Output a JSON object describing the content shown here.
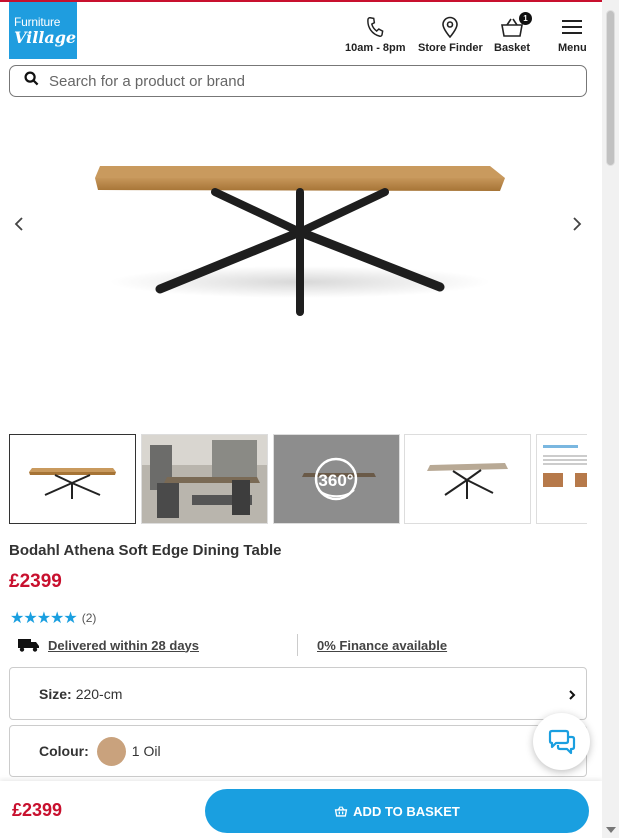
{
  "header": {
    "logo_line1": "Furniture",
    "logo_line2": "Village",
    "phone_label": "10am - 8pm",
    "store_finder_label": "Store Finder",
    "basket_label": "Basket",
    "basket_count": "1",
    "menu_label": "Menu"
  },
  "search": {
    "placeholder": "Search for a product or brand"
  },
  "gallery": {
    "thumb_360_label": "360°"
  },
  "product": {
    "title": "Bodahl Athena Soft Edge Dining Table",
    "price": "£2399",
    "rating_stars": "★★★★★",
    "rating_value": 5,
    "review_count": "(2)",
    "delivery_text": "Delivered within 28 days",
    "finance_text": "0% Finance available",
    "size_label": "Size:",
    "size_value": "220-cm",
    "colour_label": "Colour:",
    "colour_value": "1 Oil"
  },
  "bottom_bar": {
    "price": "£2399",
    "add_to_basket_label": "ADD TO BASKET"
  },
  "colors": {
    "brand_blue": "#1f9ddf",
    "price_red": "#c8102e",
    "star_blue": "#1a9fe0",
    "swatch_oak": "#c9a27d"
  }
}
